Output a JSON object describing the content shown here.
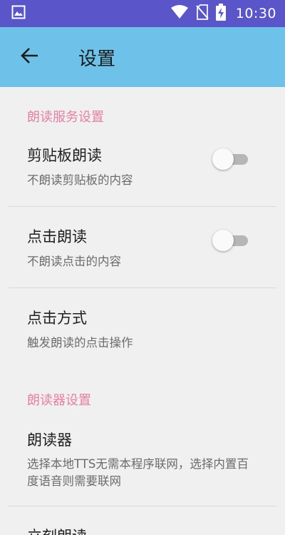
{
  "status_bar": {
    "time": "10:30",
    "icons": [
      "image-icon",
      "wifi-icon",
      "no-sim-icon",
      "battery-charging-icon"
    ]
  },
  "app_bar": {
    "title": "设置",
    "back_icon": "arrow-left-icon"
  },
  "sections": [
    {
      "header": "朗读服务设置",
      "items": [
        {
          "title": "剪贴板朗读",
          "summary": "不朗读剪贴板的内容",
          "switch_on": false
        },
        {
          "title": "点击朗读",
          "summary": "不朗读点击的内容",
          "switch_on": false
        },
        {
          "title": "点击方式",
          "summary": "触发朗读的点击操作"
        }
      ]
    },
    {
      "header": "朗读器设置",
      "items": [
        {
          "title": "朗读器",
          "summary": "选择本地TTS无需本程序联网，选择内置百度语音则需要联网"
        },
        {
          "title": "立刻朗读"
        }
      ]
    }
  ],
  "colors": {
    "status_bar": "#5a55c8",
    "app_bar": "#6ec1e8",
    "section_header": "#e37fa3",
    "background": "#f0f0f0"
  }
}
